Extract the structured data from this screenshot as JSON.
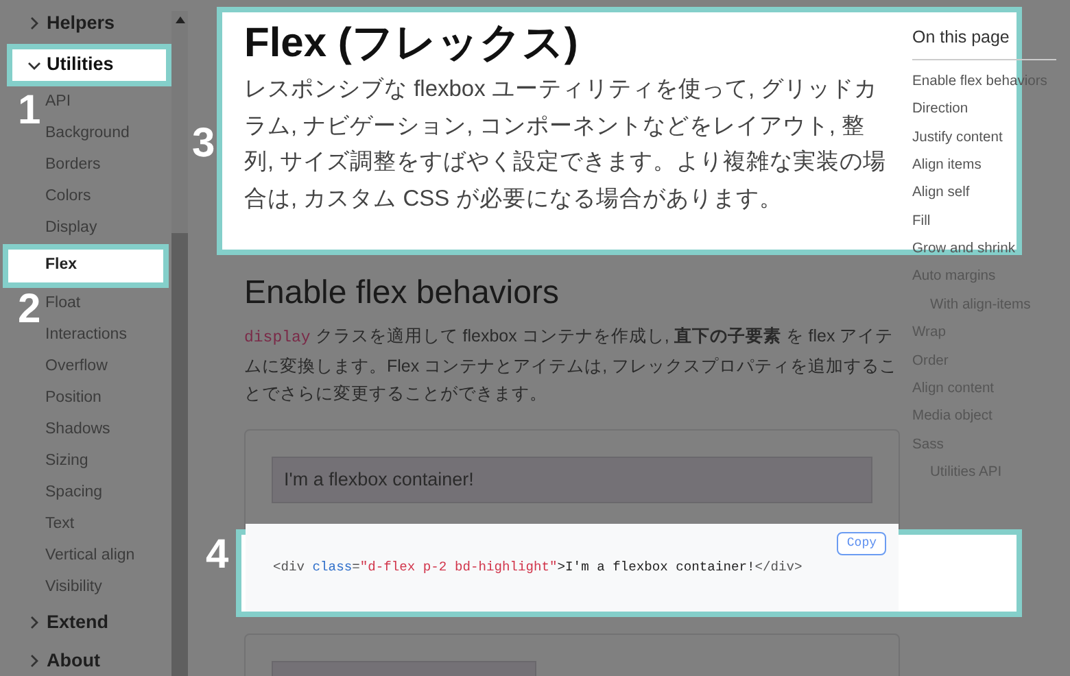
{
  "sidebar": {
    "items": [
      {
        "label": "Helpers",
        "expanded": false
      },
      {
        "label": "Utilities",
        "expanded": true,
        "callout": "1",
        "children": [
          {
            "label": "API",
            "selected": false
          },
          {
            "label": "Background",
            "selected": false
          },
          {
            "label": "Borders",
            "selected": false
          },
          {
            "label": "Colors",
            "selected": false
          },
          {
            "label": "Display",
            "selected": false
          },
          {
            "label": "Flex",
            "selected": true,
            "callout": "2"
          },
          {
            "label": "Float",
            "selected": false
          },
          {
            "label": "Interactions",
            "selected": false
          },
          {
            "label": "Overflow",
            "selected": false
          },
          {
            "label": "Position",
            "selected": false
          },
          {
            "label": "Shadows",
            "selected": false
          },
          {
            "label": "Sizing",
            "selected": false
          },
          {
            "label": "Spacing",
            "selected": false
          },
          {
            "label": "Text",
            "selected": false
          },
          {
            "label": "Vertical align",
            "selected": false
          },
          {
            "label": "Visibility",
            "selected": false
          }
        ]
      },
      {
        "label": "Extend",
        "expanded": false
      },
      {
        "label": "About",
        "expanded": false
      }
    ]
  },
  "intro": {
    "callout": "3",
    "title": "Flex (フレックス)",
    "lead": "レスポンシブな flexbox ユーティリティを使って, グリッドカラム, ナビゲーション, コンポーネントなどをレイアウト, 整列, サイズ調整をすばやく設定できます。より複雑な実装の場合は, カスタム CSS が必要になる場合があります。"
  },
  "section": {
    "heading": "Enable flex behaviors",
    "code": "display",
    "text": "クラスを適用して flexbox コンテナを作成し, **直下の子要素** を flex アイテムに変換します。Flex コンテナとアイテムは, フレックスプロパティを追加することでさらに変更することができます。"
  },
  "example": {
    "demo": "I'm a flexbox container!",
    "callout": "4",
    "copy": "Copy",
    "code_tokens": [
      {
        "text": "<div ",
        "kind": "tag"
      },
      {
        "text": "class",
        "kind": "attr"
      },
      {
        "text": "=",
        "kind": "tag"
      },
      {
        "text": "\"d-flex p-2 bd-highlight\"",
        "kind": "string"
      },
      {
        "text": ">I'm a flexbox container!",
        "kind": "plain"
      },
      {
        "text": "</div>",
        "kind": "tag"
      }
    ]
  },
  "toc": {
    "title": "On this page",
    "items": [
      {
        "label": "Enable flex behaviors"
      },
      {
        "label": "Direction"
      },
      {
        "label": "Justify content"
      },
      {
        "label": "Align items"
      },
      {
        "label": "Align self"
      },
      {
        "label": "Fill"
      },
      {
        "label": "Grow and shrink"
      },
      {
        "label": "Auto margins",
        "children": [
          {
            "label": "With align-items"
          }
        ]
      },
      {
        "label": "Wrap"
      },
      {
        "label": "Order"
      },
      {
        "label": "Align content"
      },
      {
        "label": "Media object"
      },
      {
        "label": "Sass",
        "children": [
          {
            "label": "Utilities API"
          }
        ]
      }
    ]
  }
}
